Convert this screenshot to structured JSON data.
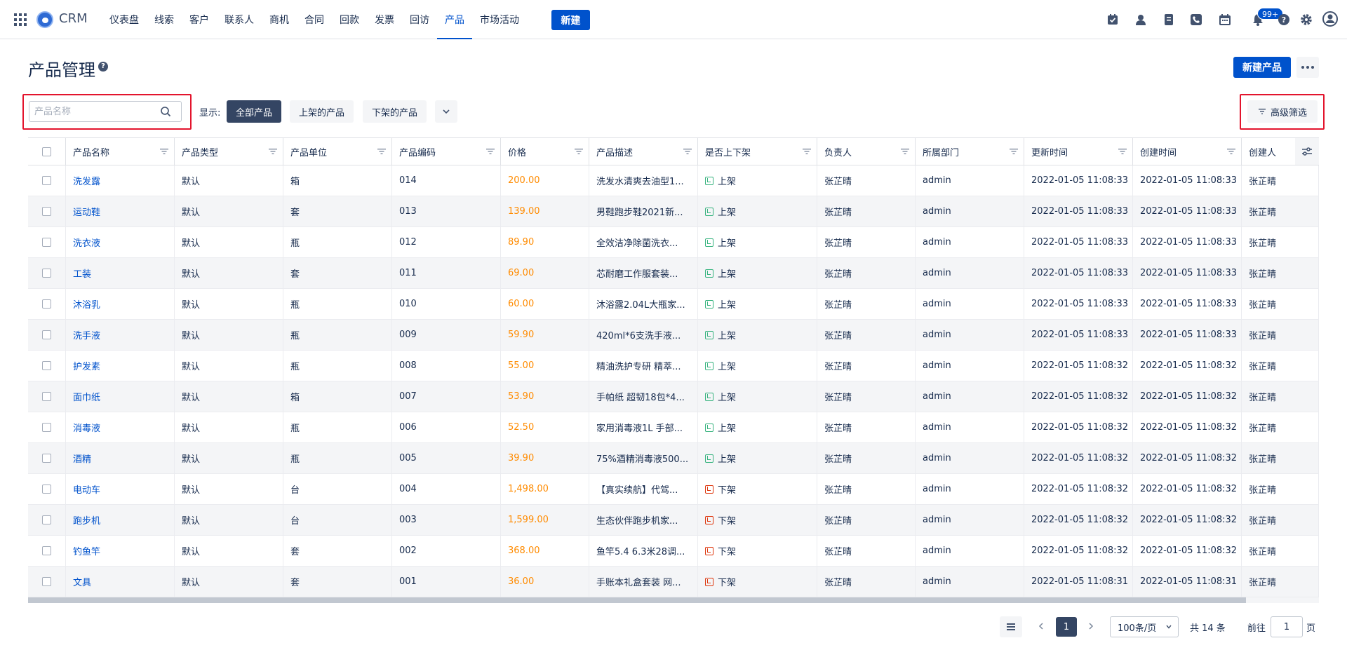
{
  "topnav": {
    "brand": "CRM",
    "items": [
      {
        "label": "仪表盘",
        "active": false
      },
      {
        "label": "线索",
        "active": false
      },
      {
        "label": "客户",
        "active": false
      },
      {
        "label": "联系人",
        "active": false
      },
      {
        "label": "商机",
        "active": false
      },
      {
        "label": "合同",
        "active": false
      },
      {
        "label": "回款",
        "active": false
      },
      {
        "label": "发票",
        "active": false
      },
      {
        "label": "回访",
        "active": false
      },
      {
        "label": "产品",
        "active": true
      },
      {
        "label": "市场活动",
        "active": false
      }
    ],
    "new_label": "新建",
    "notification_badge": "99+",
    "icons": [
      "task-icon",
      "contact-icon",
      "document-icon",
      "phone-icon",
      "calendar-icon",
      "bell-icon",
      "help-icon",
      "settings-icon",
      "user-avatar-icon"
    ]
  },
  "header": {
    "title": "产品管理",
    "help": "?",
    "new_product_label": "新建产品"
  },
  "filters": {
    "search_placeholder": "产品名称",
    "search_value": "",
    "show_label": "显示:",
    "segments": [
      "全部产品",
      "上架的产品",
      "下架的产品"
    ],
    "active_segment": 0,
    "advanced_label": "高级筛选"
  },
  "table": {
    "columns": [
      "产品名称",
      "产品类型",
      "产品单位",
      "产品编码",
      "价格",
      "产品描述",
      "是否上下架",
      "负责人",
      "所属部门",
      "更新时间",
      "创建时间",
      "创建人"
    ],
    "rows": [
      {
        "name": "洗发露",
        "type": "默认",
        "unit": "箱",
        "code": "014",
        "price": "200.00",
        "desc": "洗发水清爽去油型1...",
        "status": "上架",
        "on": true,
        "owner": "张芷晴",
        "dept": "admin",
        "updated": "2022-01-05 11:08:33",
        "created": "2022-01-05 11:08:33",
        "creator": "张芷晴"
      },
      {
        "name": "运动鞋",
        "type": "默认",
        "unit": "套",
        "code": "013",
        "price": "139.00",
        "desc": "男鞋跑步鞋2021新...",
        "status": "上架",
        "on": true,
        "owner": "张芷晴",
        "dept": "admin",
        "updated": "2022-01-05 11:08:33",
        "created": "2022-01-05 11:08:33",
        "creator": "张芷晴"
      },
      {
        "name": "洗衣液",
        "type": "默认",
        "unit": "瓶",
        "code": "012",
        "price": "89.90",
        "desc": "全效洁净除菌洗衣...",
        "status": "上架",
        "on": true,
        "owner": "张芷晴",
        "dept": "admin",
        "updated": "2022-01-05 11:08:33",
        "created": "2022-01-05 11:08:33",
        "creator": "张芷晴"
      },
      {
        "name": "工装",
        "type": "默认",
        "unit": "套",
        "code": "011",
        "price": "69.00",
        "desc": "芯耐磨工作服套装...",
        "status": "上架",
        "on": true,
        "owner": "张芷晴",
        "dept": "admin",
        "updated": "2022-01-05 11:08:33",
        "created": "2022-01-05 11:08:33",
        "creator": "张芷晴"
      },
      {
        "name": "沐浴乳",
        "type": "默认",
        "unit": "瓶",
        "code": "010",
        "price": "60.00",
        "desc": "沐浴露2.04L大瓶家...",
        "status": "上架",
        "on": true,
        "owner": "张芷晴",
        "dept": "admin",
        "updated": "2022-01-05 11:08:33",
        "created": "2022-01-05 11:08:33",
        "creator": "张芷晴"
      },
      {
        "name": "洗手液",
        "type": "默认",
        "unit": "瓶",
        "code": "009",
        "price": "59.90",
        "desc": "420ml*6支洗手液...",
        "status": "上架",
        "on": true,
        "owner": "张芷晴",
        "dept": "admin",
        "updated": "2022-01-05 11:08:33",
        "created": "2022-01-05 11:08:33",
        "creator": "张芷晴"
      },
      {
        "name": "护发素",
        "type": "默认",
        "unit": "瓶",
        "code": "008",
        "price": "55.00",
        "desc": "精油洗护专研 精萃...",
        "status": "上架",
        "on": true,
        "owner": "张芷晴",
        "dept": "admin",
        "updated": "2022-01-05 11:08:32",
        "created": "2022-01-05 11:08:32",
        "creator": "张芷晴"
      },
      {
        "name": "面巾纸",
        "type": "默认",
        "unit": "箱",
        "code": "007",
        "price": "53.90",
        "desc": "手帕纸 超韧18包*4...",
        "status": "上架",
        "on": true,
        "owner": "张芷晴",
        "dept": "admin",
        "updated": "2022-01-05 11:08:32",
        "created": "2022-01-05 11:08:32",
        "creator": "张芷晴"
      },
      {
        "name": "消毒液",
        "type": "默认",
        "unit": "瓶",
        "code": "006",
        "price": "52.50",
        "desc": "家用消毒液1L 手部...",
        "status": "上架",
        "on": true,
        "owner": "张芷晴",
        "dept": "admin",
        "updated": "2022-01-05 11:08:32",
        "created": "2022-01-05 11:08:32",
        "creator": "张芷晴"
      },
      {
        "name": "酒精",
        "type": "默认",
        "unit": "瓶",
        "code": "005",
        "price": "39.90",
        "desc": "75%酒精消毒液500...",
        "status": "上架",
        "on": true,
        "owner": "张芷晴",
        "dept": "admin",
        "updated": "2022-01-05 11:08:32",
        "created": "2022-01-05 11:08:32",
        "creator": "张芷晴"
      },
      {
        "name": "电动车",
        "type": "默认",
        "unit": "台",
        "code": "004",
        "price": "1,498.00",
        "desc": "【真实续航】代驾...",
        "status": "下架",
        "on": false,
        "owner": "张芷晴",
        "dept": "admin",
        "updated": "2022-01-05 11:08:32",
        "created": "2022-01-05 11:08:32",
        "creator": "张芷晴"
      },
      {
        "name": "跑步机",
        "type": "默认",
        "unit": "台",
        "code": "003",
        "price": "1,599.00",
        "desc": "生态伙伴跑步机家...",
        "status": "下架",
        "on": false,
        "owner": "张芷晴",
        "dept": "admin",
        "updated": "2022-01-05 11:08:32",
        "created": "2022-01-05 11:08:32",
        "creator": "张芷晴"
      },
      {
        "name": "钓鱼竿",
        "type": "默认",
        "unit": "套",
        "code": "002",
        "price": "368.00",
        "desc": "鱼竿5.4 6.3米28调...",
        "status": "下架",
        "on": false,
        "owner": "张芷晴",
        "dept": "admin",
        "updated": "2022-01-05 11:08:32",
        "created": "2022-01-05 11:08:32",
        "creator": "张芷晴"
      },
      {
        "name": "文具",
        "type": "默认",
        "unit": "套",
        "code": "001",
        "price": "36.00",
        "desc": "手账本礼盒套装 网...",
        "status": "下架",
        "on": false,
        "owner": "张芷晴",
        "dept": "admin",
        "updated": "2022-01-05 11:08:31",
        "created": "2022-01-05 11:08:31",
        "creator": "张芷晴"
      }
    ]
  },
  "pagination": {
    "current": "1",
    "page_size": "100条/页",
    "total": "共 14 条",
    "goto_label": "前往",
    "goto_value": "1",
    "page_suffix": "页"
  },
  "colors": {
    "primary": "#0052cc",
    "dark": "#344563",
    "price": "#ff8b00",
    "on_shelf": "#36b37e",
    "off_shelf": "#de350b",
    "highlight": "#e3142d"
  }
}
